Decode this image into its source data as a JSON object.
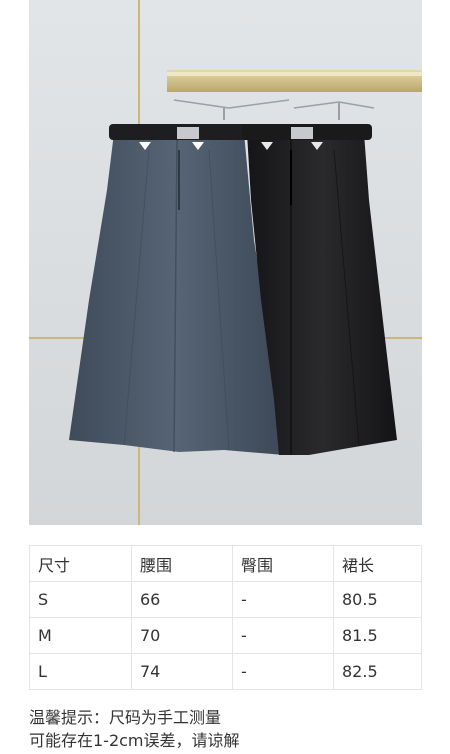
{
  "size_table": {
    "headers": [
      "尺寸",
      "腰围",
      "臀围",
      "裙长"
    ],
    "rows": [
      [
        "S",
        "66",
        "-",
        "80.5"
      ],
      [
        "M",
        "70",
        "-",
        "81.5"
      ],
      [
        "L",
        "74",
        "-",
        "82.5"
      ]
    ]
  },
  "note": {
    "line1": "温馨提示：尺码为手工测量",
    "line2": "可能存在1-2cm误差，请谅解"
  },
  "colors": {
    "grey_skirt": "#4b5968",
    "black_skirt": "#1c1c1e",
    "background": "#d9dcde"
  }
}
